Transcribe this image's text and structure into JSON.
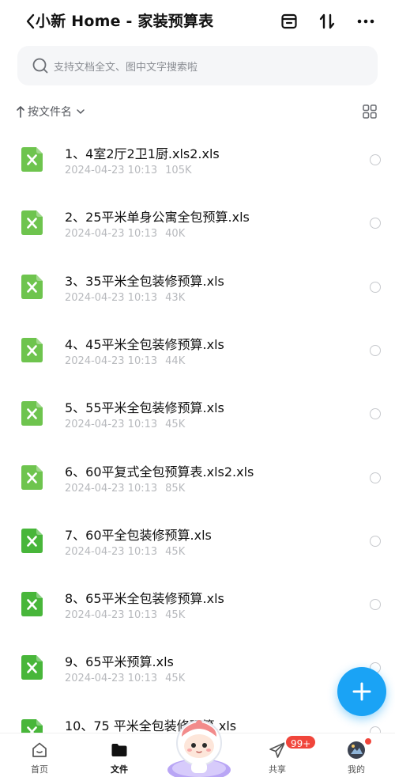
{
  "header": {
    "title": "小新 Home - 家装预算表"
  },
  "search": {
    "placeholder": "支持文档全文、图中文字搜索啦"
  },
  "sort": {
    "label": "按文件名"
  },
  "files": [
    {
      "name": "1、4室2厅2卫1厨.xls2.xls",
      "date": "2024-04-23 10:13",
      "size": "105K"
    },
    {
      "name": "2、25平米单身公寓全包预算.xls",
      "date": "2024-04-23 10:13",
      "size": "40K"
    },
    {
      "name": "3、35平米全包装修预算.xls",
      "date": "2024-04-23 10:13",
      "size": "43K"
    },
    {
      "name": "4、45平米全包装修预算.xls",
      "date": "2024-04-23 10:13",
      "size": "44K"
    },
    {
      "name": "5、55平米全包装修预算.xls",
      "date": "2024-04-23 10:13",
      "size": "45K"
    },
    {
      "name": "6、60平复式全包预算表.xls2.xls",
      "date": "2024-04-23 10:13",
      "size": "85K"
    },
    {
      "name": "7、60平全包装修预算.xls",
      "date": "2024-04-23 10:13",
      "size": "45K"
    },
    {
      "name": "8、65平米全包装修预算.xls",
      "date": "2024-04-23 10:13",
      "size": "45K"
    },
    {
      "name": "9、65平米预算.xls",
      "date": "2024-04-23 10:13",
      "size": "45K"
    },
    {
      "name": "10、75 平米全包装修预算.xls",
      "date": "",
      "size": ""
    }
  ],
  "tabbar": {
    "home": "首页",
    "files": "文件",
    "share": "共享",
    "mine": "我的",
    "share_badge": "99+"
  },
  "colors": {
    "accent": "#1aa3f5",
    "excel_green": "#5cbd3d",
    "badge_red": "#f0453b"
  }
}
